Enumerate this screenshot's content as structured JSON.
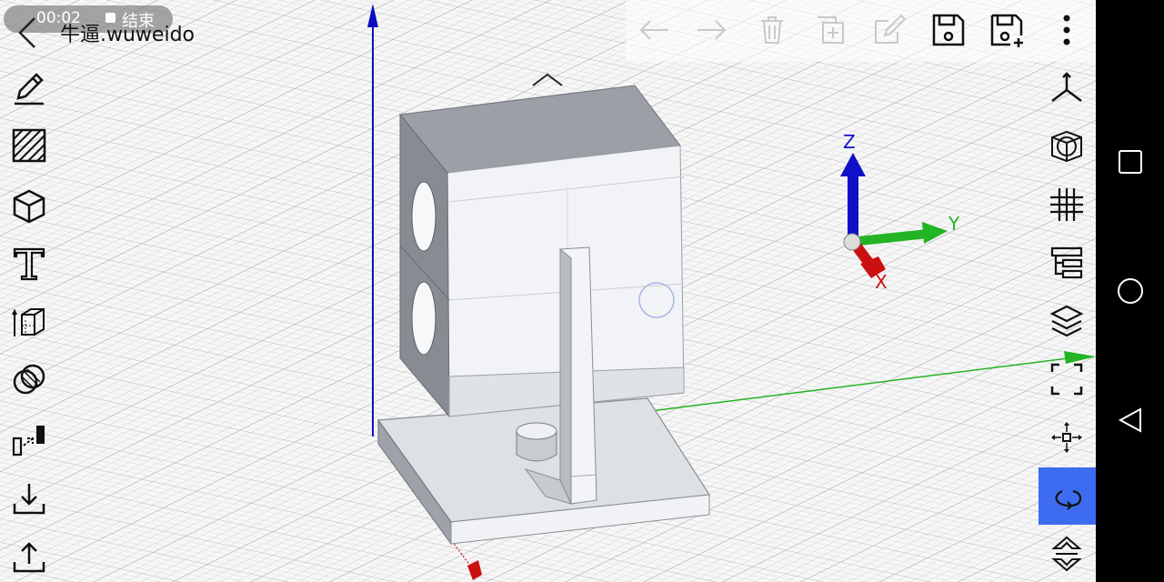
{
  "app": {
    "recording": {
      "time": "00:02",
      "end_label": "结束"
    },
    "title": "牛逼.wuweido"
  },
  "top_toolbar": [
    {
      "name": "undo-button",
      "icon": "arrow-left-icon",
      "enabled": false
    },
    {
      "name": "redo-button",
      "icon": "arrow-right-icon",
      "enabled": false
    },
    {
      "name": "delete-button",
      "icon": "trash-icon",
      "enabled": false
    },
    {
      "name": "duplicate-button",
      "icon": "copy-plus-icon",
      "enabled": false
    },
    {
      "name": "edit-button",
      "icon": "edit-icon",
      "enabled": false
    },
    {
      "name": "save-button",
      "icon": "save-icon",
      "enabled": true
    },
    {
      "name": "save-as-button",
      "icon": "save-plus-icon",
      "enabled": true
    },
    {
      "name": "more-button",
      "icon": "more-vertical-icon",
      "enabled": true
    }
  ],
  "left_tools": [
    "sketch-pencil-icon",
    "hatch-icon",
    "cube-icon",
    "text-icon",
    "extrude-icon",
    "boolean-spheres-icon",
    "transform-icon",
    "import-icon",
    "export-icon"
  ],
  "right_tools": [
    "axes-view-icon",
    "render-mode-icon",
    "grid-icon",
    "tree-icon",
    "layers-icon",
    "fit-view-icon",
    "pan-icon",
    "rotate-icon",
    "flip-view-icon"
  ],
  "active_right_tool": "rotate-icon",
  "gizmo": {
    "x_label": "X",
    "y_label": "Y",
    "z_label": "Z"
  },
  "colors": {
    "accent": "#3d6cf0",
    "axis_x": "#cc1010",
    "axis_y": "#22b422",
    "axis_z": "#0a10c0",
    "grid": "#c8c8c8",
    "navbar": "#000000"
  }
}
